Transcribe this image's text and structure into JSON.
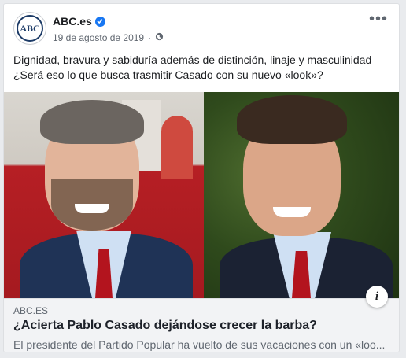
{
  "post": {
    "page_name": "ABC.es",
    "avatar_text": "ABC",
    "date": "19 de agosto de 2019",
    "audience_icon": "globe-icon",
    "more_icon": "more-options-icon",
    "text_line1": "Dignidad, bravura y sabiduría además de distinción, linaje y masculinidad",
    "text_line2": "¿Será eso lo que busca trasmitir Casado con su nuevo «look»?"
  },
  "link": {
    "domain": "ABC.ES",
    "title": "¿Acierta Pablo Casado dejándose crecer la barba?",
    "description": "El presidente del Partido Popular ha vuelto de sus vacaciones con un «loo..."
  },
  "colors": {
    "facebook_blue": "#1877f2",
    "abc_navy": "#1d3b67",
    "text": "#1c1e21",
    "secondary_text": "#606770"
  }
}
